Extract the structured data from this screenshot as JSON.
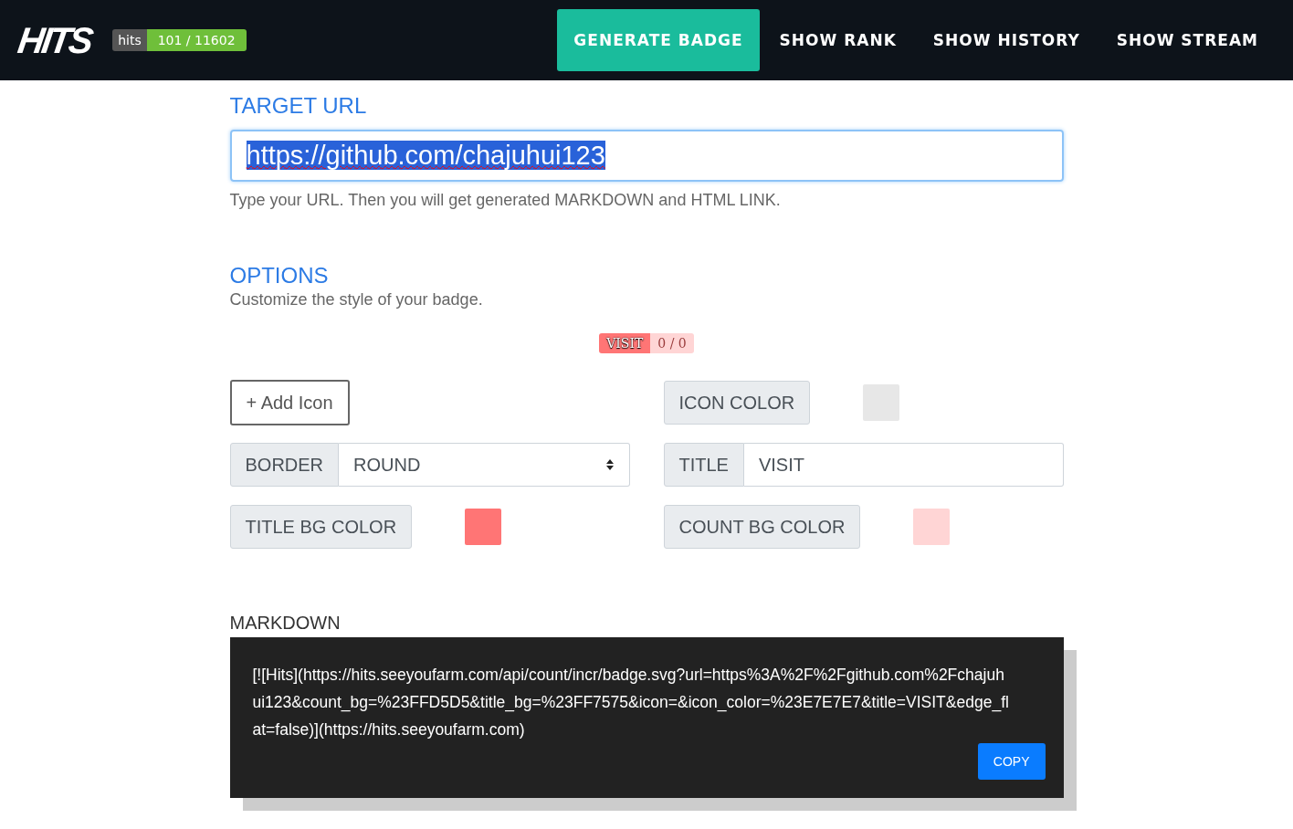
{
  "nav": {
    "logo": "HITS",
    "counter": {
      "label": "hits",
      "value": "101 / 11602"
    },
    "items": [
      {
        "label": "GENERATE BADGE",
        "selected": true
      },
      {
        "label": "SHOW RANK",
        "selected": false
      },
      {
        "label": "SHOW HISTORY",
        "selected": false
      },
      {
        "label": "SHOW STREAM",
        "selected": false
      }
    ]
  },
  "target": {
    "heading": "TARGET URL",
    "value": "https://github.com/chajuhui123",
    "help": "Type your URL. Then you will get generated MARKDOWN and HTML LINK."
  },
  "options": {
    "heading": "OPTIONS",
    "subtitle": "Customize the style of your badge.",
    "preview": {
      "title": "VISIT",
      "count": "0 / 0"
    },
    "controls": [
      {
        "kind": "button",
        "label": "+ Add Icon"
      },
      {
        "kind": "color",
        "label": "ICON COLOR",
        "color": "#e7e7e7"
      },
      {
        "kind": "select",
        "label": "BORDER",
        "value": "ROUND"
      },
      {
        "kind": "text",
        "label": "TITLE",
        "value": "VISIT"
      },
      {
        "kind": "color",
        "label": "TITLE BG COLOR",
        "color": "#ff7575"
      },
      {
        "kind": "color",
        "label": "COUNT BG COLOR",
        "color": "#ffd5d5"
      }
    ]
  },
  "markdown": {
    "heading": "MARKDOWN",
    "code": "[![Hits](https://hits.seeyoufarm.com/api/count/incr/badge.svg?url=https%3A%2F%2Fgithub.com%2Fchajuhui123&count_bg=%23FFD5D5&title_bg=%23FF7575&icon=&icon_color=%23E7E7E7&title=VISIT&edge_flat=false)](https://hits.seeyoufarm.com)",
    "copy": "COPY"
  }
}
